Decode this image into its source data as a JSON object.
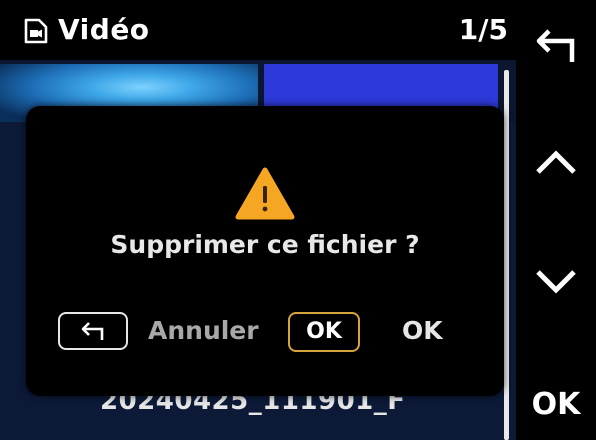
{
  "header": {
    "icon": "file-video-icon",
    "title": "Vidéo",
    "counter": "1/5"
  },
  "file_list": {
    "visible_filename": "20240425_111901_F"
  },
  "dialog": {
    "icon": "warning-icon",
    "icon_color": "#f5a623",
    "message": "Supprimer ce fichier ?",
    "back_key_icon": "return-arrow-icon",
    "cancel_label": "Annuler",
    "ok_key_label": "OK",
    "ok_key_color": "#d7a33e",
    "ok_label": "OK"
  },
  "side_buttons": {
    "back_icon": "return-arrow-icon",
    "up_icon": "chevron-up-icon",
    "down_icon": "chevron-down-icon",
    "ok_label": "OK"
  }
}
